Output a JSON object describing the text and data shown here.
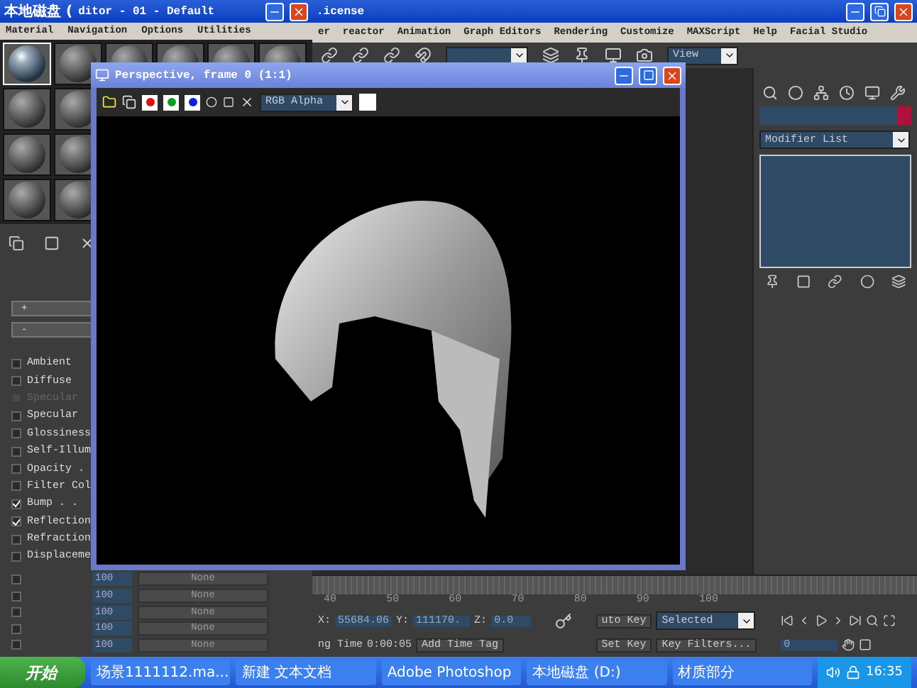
{
  "material_editor": {
    "overlap_title": "本地磁盘 (",
    "title": "ditor - 01 - Default",
    "menu": [
      "Material",
      "Navigation",
      "Options",
      "Utilities"
    ],
    "sample_slots": [
      [
        {
          "selected": true
        },
        {
          "selected": false
        },
        {
          "selected": false
        },
        {
          "selected": false
        },
        {
          "selected": false
        },
        {
          "selected": false
        }
      ],
      [
        {
          "selected": false
        },
        {
          "selected": false
        }
      ],
      [
        {
          "selected": false
        },
        {
          "selected": false
        }
      ],
      [
        {
          "selected": false
        },
        {
          "selected": false
        }
      ]
    ],
    "rollouts": [
      "+",
      "-"
    ],
    "maps": [
      {
        "label": "Ambient",
        "checked": false,
        "disabled": false
      },
      {
        "label": "Diffuse",
        "checked": false,
        "disabled": false
      },
      {
        "label": "Specular",
        "checked": false,
        "disabled": true
      },
      {
        "label": "Specular",
        "checked": false,
        "disabled": false
      },
      {
        "label": "Glossiness",
        "checked": false,
        "disabled": false
      },
      {
        "label": "Self-Illum",
        "checked": false,
        "disabled": false
      },
      {
        "label": "Opacity .",
        "checked": false,
        "disabled": false
      },
      {
        "label": "Filter Col",
        "checked": false,
        "disabled": false
      },
      {
        "label": "Bump . .",
        "checked": true,
        "disabled": false
      },
      {
        "label": "Reflection",
        "checked": true,
        "disabled": false
      },
      {
        "label": "Refraction",
        "checked": false,
        "disabled": false
      },
      {
        "label": "Displaceme",
        "checked": false,
        "disabled": false
      }
    ],
    "extra_maps": [
      {
        "checked": false,
        "amount": "100",
        "map": "None"
      },
      {
        "checked": false,
        "amount": "100",
        "map": "None"
      },
      {
        "checked": false,
        "amount": "100",
        "map": "None"
      },
      {
        "checked": false,
        "amount": "100",
        "map": "None"
      },
      {
        "checked": false,
        "amount": "100",
        "map": "None"
      }
    ]
  },
  "render_window": {
    "title": "Perspective, frame 0 (1:1)",
    "channels": [
      {
        "color": "#e01010",
        "on": true
      },
      {
        "color": "#10a020",
        "on": true
      },
      {
        "color": "#1020e0",
        "on": true
      }
    ],
    "display": "RGB Alpha"
  },
  "max_window": {
    "title": ".icense",
    "menu": [
      "er",
      "reactor",
      "Animation",
      "Graph Editors",
      "Rendering",
      "Customize",
      "MAXScript",
      "Help",
      "Facial Studio"
    ],
    "view": "View",
    "modifier_list": "Modifier List",
    "ticks": [
      "40",
      "50",
      "60",
      "70",
      "80",
      "90",
      "100"
    ],
    "coords": [
      {
        "axis": "X:",
        "value": "55684.06"
      },
      {
        "axis": "Y:",
        "value": "111170."
      },
      {
        "axis": "Z:",
        "value": "0.0"
      }
    ],
    "time_label": "ng Time",
    "time_value": "0:00:05",
    "add_time_tag": "Add Time Tag",
    "auto_key": "uto Key",
    "key_mode": "Selected",
    "set_key": "Set Key",
    "key_filters": "Key Filters...",
    "frame": "0"
  },
  "taskbar": {
    "start": "开始",
    "items": [
      {
        "label": "场景1111112.ma..."
      },
      {
        "label": "新建 文本文档"
      },
      {
        "label": "Adobe Photoshop"
      },
      {
        "label": "本地磁盘 (D:)"
      },
      {
        "label": "材质部分"
      }
    ],
    "clock": "16:35"
  }
}
